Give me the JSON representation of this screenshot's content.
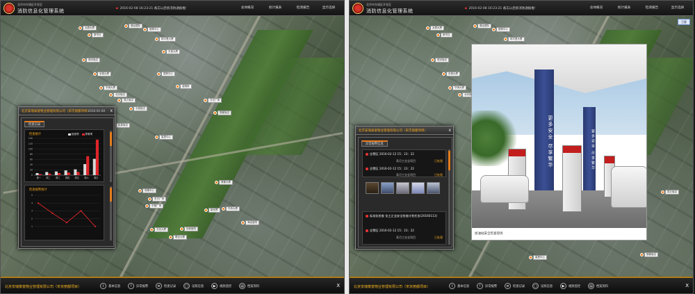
{
  "header": {
    "subtitle": "北京市东城区开发区",
    "title": "消防信息化管理系统",
    "ticker": "2016-02-08 16:23:21  备忘以后统消防通报推!",
    "nav": [
      "总体概况",
      "统计报表",
      "检测报告",
      "显示选择"
    ]
  },
  "map_tool_label": "卫星",
  "markers_left": [
    "太原大厦",
    "新华社",
    "鼎龙国际",
    "银泰中心",
    "和平里大厦",
    "天宝大厦",
    "燕京饭店",
    "京城大厦",
    "华润大厦",
    "北京饭店",
    "国贸中心",
    "昆仑饭店",
    "长城饭店",
    "嘉里中心",
    "万达广场",
    "丽都饭店",
    "金融街",
    "恒基中心",
    "东方广场",
    "中粮广场",
    "新世界",
    "首都大厦",
    "华侨大厦",
    "海淀医院",
    "协和医院",
    "文化大厦",
    "联合大厦",
    "民族饭店"
  ],
  "markers_right": [
    "太原大厦",
    "新华社",
    "鼎龙国际",
    "银泰中心",
    "和平里大厦",
    "天宝大厦",
    "燕京饭店",
    "京城大厦",
    "华润大厦",
    "北京饭店",
    "国贸中心",
    "昆仑饭店",
    "嘉里中心",
    "丽都饭店",
    "东方广场",
    "首都大厦"
  ],
  "left_popup": {
    "title": "北京安瑞泰富物业管理有限公司（宋京丽都项目）",
    "date": "2016-01-08",
    "close": "x",
    "tab": "检查记录",
    "chart1_title": "检查统计",
    "chart2_title": "检查报警统计"
  },
  "right_popup": {
    "title": "北京安瑞泰富物业管理有限公司（宋京丽都项目）",
    "close": "x",
    "tab": "异常报警信息",
    "records": [
      {
        "line": "告警区 2016-02-12 15：23：22",
        "unit": "寿月工业全项目",
        "badge": "已处理"
      },
      {
        "line": "告警区 2016-02-12 15：23：22",
        "unit": "寿月工业全项目",
        "badge": "已处理"
      },
      {
        "line": "标准化检查 化工企业安全检查计划任务(20160113)",
        "unit": "",
        "badge": ""
      },
      {
        "line": "告警区 2016-02-12 15：23：22",
        "unit": "寿月工业全项目",
        "badge": "已处理"
      }
    ]
  },
  "photo": {
    "sign1": "更多安全 尽享繁华",
    "sign2": "更多安全 尽享繁华",
    "caption": "加油站安全检查现场"
  },
  "bottom": {
    "company": "北京安瑞泰富物业管理有限公司（宋京丽都项目）",
    "tools": [
      "基本信息",
      "异常报警",
      "检查记录",
      "证照信息",
      "视频监控",
      "档案资料"
    ],
    "close": "X"
  },
  "chart_data": [
    {
      "type": "bar",
      "title": "检查统计",
      "legend": [
        "检查项",
        "异常项"
      ],
      "categories": [
        "周一",
        "周二",
        "周三",
        "周四",
        "周五",
        "周六",
        "周日"
      ],
      "yticks": [
        0,
        20,
        40,
        60,
        80,
        100,
        120,
        140
      ],
      "ylim": [
        0,
        140
      ],
      "series": [
        {
          "name": "检查项",
          "values": [
            8,
            12,
            14,
            18,
            22,
            42,
            62
          ]
        },
        {
          "name": "异常项",
          "values": [
            4,
            6,
            8,
            10,
            12,
            72,
            135
          ]
        }
      ],
      "colors": [
        "#d8d8d8",
        "#e0252a"
      ]
    },
    {
      "type": "line",
      "title": "检查报警统计",
      "ylim": [
        0,
        5
      ],
      "yticks": [
        1,
        2,
        3,
        4,
        5
      ],
      "x": [
        1,
        2,
        3,
        4,
        5
      ],
      "series": [
        {
          "name": "",
          "values": [
            4,
            2.7,
            1.5,
            3,
            1
          ]
        }
      ],
      "colors": [
        "#e0252a"
      ]
    }
  ]
}
